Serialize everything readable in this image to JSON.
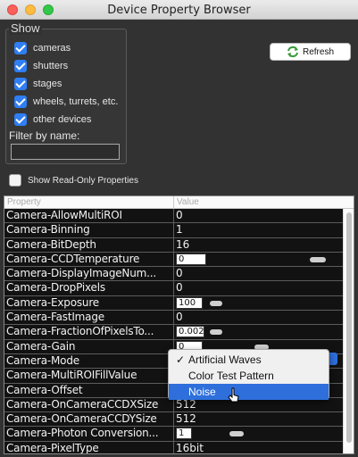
{
  "window": {
    "title": "Device Property Browser"
  },
  "show_group": {
    "label": "Show",
    "checkboxes": [
      {
        "label": "cameras",
        "checked": true
      },
      {
        "label": "shutters",
        "checked": true
      },
      {
        "label": "stages",
        "checked": true
      },
      {
        "label": "wheels, turrets, etc.",
        "checked": true
      },
      {
        "label": "other devices",
        "checked": true
      }
    ],
    "filter_label": "Filter by name:",
    "filter_value": ""
  },
  "refresh_button": {
    "label": "Refresh",
    "icon": "refresh-icon"
  },
  "read_only": {
    "label": "Show Read-Only Properties",
    "checked": false
  },
  "table": {
    "headers": [
      "Property",
      "Value"
    ],
    "rows": [
      {
        "property": "Camera-AllowMultiROI",
        "value": "0"
      },
      {
        "property": "Camera-Binning",
        "value": "1"
      },
      {
        "property": "Camera-BitDepth",
        "value": "16"
      },
      {
        "property": "Camera-CCDTemperature",
        "value": "0"
      },
      {
        "property": "Camera-DisplayImageNum...",
        "value": "0"
      },
      {
        "property": "Camera-DropPixels",
        "value": "0"
      },
      {
        "property": "Camera-Exposure",
        "value": "100"
      },
      {
        "property": "Camera-FastImage",
        "value": "0"
      },
      {
        "property": "Camera-FractionOfPixelsTo...",
        "value": "0.002"
      },
      {
        "property": "Camera-Gain",
        "value": "0"
      },
      {
        "property": "Camera-Mode",
        "value": ""
      },
      {
        "property": "Camera-MultiROIFillValue",
        "value": ""
      },
      {
        "property": "Camera-Offset",
        "value": ""
      },
      {
        "property": "Camera-OnCameraCCDXSize",
        "value": "512"
      },
      {
        "property": "Camera-OnCameraCCDYSize",
        "value": "512"
      },
      {
        "property": "Camera-Photon Conversion...",
        "value": "1"
      },
      {
        "property": "Camera-PixelType",
        "value": "16bit"
      }
    ]
  },
  "mode_dropdown": {
    "options": [
      "Artificial Waves",
      "Color Test Pattern",
      "Noise"
    ],
    "checked": "Artificial Waves",
    "highlighted": "Noise",
    "check_glyph": "✓"
  }
}
